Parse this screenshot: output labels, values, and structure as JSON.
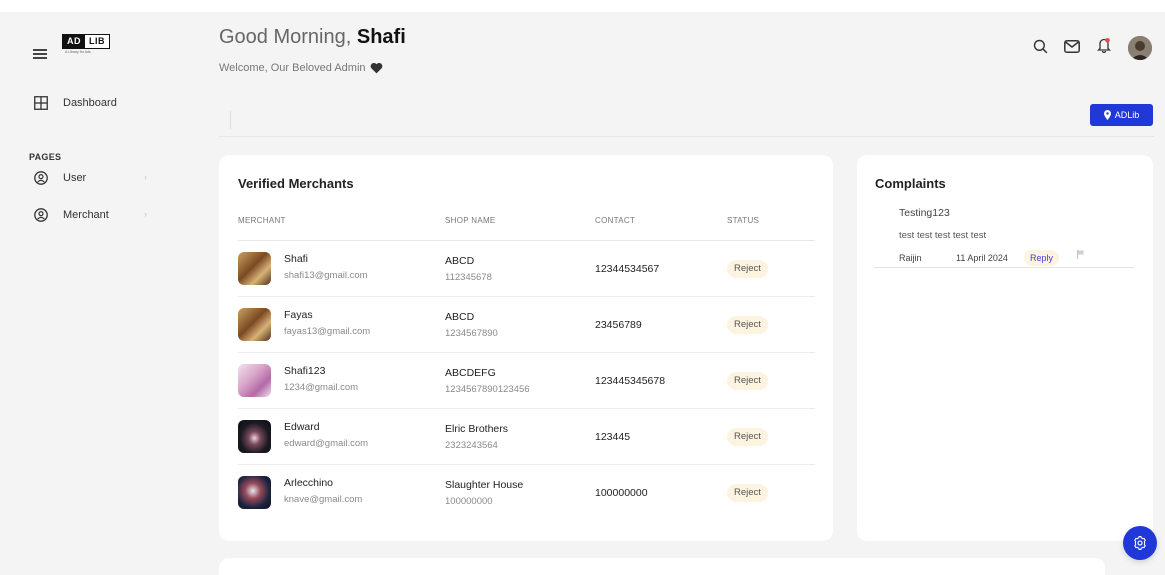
{
  "brand": {
    "logo_left": "AD",
    "logo_right": "LIB",
    "tagline": "A Library for Ads"
  },
  "sidebar": {
    "dashboard_label": "Dashboard",
    "pages_label": "PAGES",
    "items": [
      {
        "label": "User",
        "icon": "user-circle-icon"
      },
      {
        "label": "Merchant",
        "icon": "user-circle-icon"
      }
    ]
  },
  "header": {
    "greeting": "Good Morning,",
    "user_name": "Shafi",
    "subtitle": "Welcome, Our Beloved Admin",
    "icons": [
      "search-icon",
      "mail-icon",
      "bell-icon",
      "avatar"
    ],
    "adlib_button_label": "ADLib"
  },
  "merchants": {
    "title": "Verified Merchants",
    "columns": [
      "MERCHANT",
      "SHOP NAME",
      "CONTACT",
      "STATUS"
    ],
    "rows": [
      {
        "name": "Shafi",
        "email": "shafi13@gmail.com",
        "shop": "ABCD",
        "shop_no": "112345678",
        "contact": "12344534567",
        "status": "Reject"
      },
      {
        "name": "Fayas",
        "email": "fayas13@gmail.com",
        "shop": "ABCD",
        "shop_no": "1234567890",
        "contact": "23456789",
        "status": "Reject"
      },
      {
        "name": "Shafi123",
        "email": "1234@gmail.com",
        "shop": "ABCDEFG",
        "shop_no": "1234567890123456",
        "contact": "123445345678",
        "status": "Reject"
      },
      {
        "name": "Edward",
        "email": "edward@gmail.com",
        "shop": "Elric Brothers",
        "shop_no": "2323243564",
        "contact": "123445",
        "status": "Reject"
      },
      {
        "name": "Arlecchino",
        "email": "knave@gmail.com",
        "shop": "Slaughter House",
        "shop_no": "100000000",
        "contact": "100000000",
        "status": "Reject"
      }
    ]
  },
  "complaints": {
    "title": "Complaints",
    "items": [
      {
        "subject": "Testing123",
        "body": "test test test test test",
        "author": "Raijin",
        "date": "11 April 2024",
        "reply_label": "Reply"
      }
    ]
  },
  "colors": {
    "accent": "#2138d9",
    "status_bg": "#fdf3e1",
    "reply_text": "#4b3cd1"
  }
}
